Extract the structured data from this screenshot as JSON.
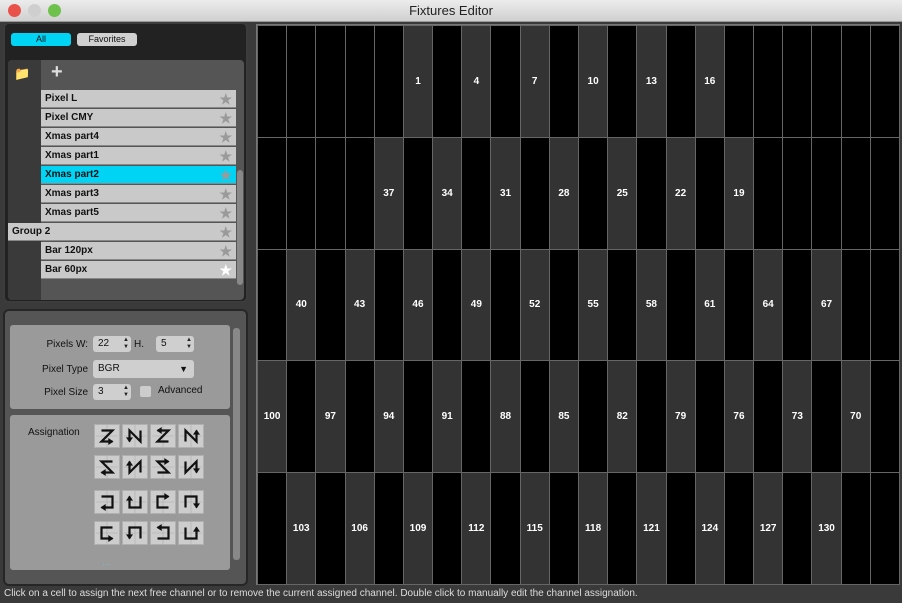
{
  "window": {
    "title": "Fixtures Editor"
  },
  "filters": [
    {
      "label": "All",
      "active": true
    },
    {
      "label": "Favorites",
      "active": false
    }
  ],
  "list": {
    "add_icon": "plus-icon",
    "folder_icon": "add-folder-icon",
    "items": [
      {
        "label": "Pixel L",
        "level": 1,
        "favorite": false,
        "selected": false
      },
      {
        "label": "Pixel CMY",
        "level": 1,
        "favorite": false,
        "selected": false
      },
      {
        "label": "Xmas part4",
        "level": 1,
        "favorite": false,
        "selected": false
      },
      {
        "label": "Xmas part1",
        "level": 1,
        "favorite": false,
        "selected": false
      },
      {
        "label": "Xmas part2",
        "level": 1,
        "favorite": false,
        "selected": true
      },
      {
        "label": "Xmas part3",
        "level": 1,
        "favorite": false,
        "selected": false
      },
      {
        "label": "Xmas part5",
        "level": 1,
        "favorite": false,
        "selected": false
      },
      {
        "label": "Group 2",
        "level": 0,
        "favorite": false,
        "selected": false
      },
      {
        "label": "Bar 120px",
        "level": 1,
        "favorite": false,
        "selected": false
      },
      {
        "label": "Bar 60px",
        "level": 1,
        "favorite": true,
        "selected": false
      }
    ]
  },
  "settings": {
    "pixels_w_label": "Pixels W:",
    "pixels_w": "22",
    "h_label": "H.",
    "h": "5",
    "pixel_type_label": "Pixel Type",
    "pixel_type": "BGR",
    "pixel_size_label": "Pixel Size",
    "pixel_size": "3",
    "advanced_label": "Advanced",
    "advanced": false,
    "assignation_label": "Assignation",
    "assignation_icons": [
      "z-arrow-right",
      "n-arrow-down",
      "z-arrow-left",
      "n-arrow-up",
      "s-arrow-left",
      "n-rev-arrow-up",
      "s-arrow-right",
      "n-rev-arrow-down",
      "snake-left",
      "snake-up",
      "snake-right",
      "snake-down",
      "snake-right-b",
      "snake-down-b",
      "snake-left-b",
      "snake-up-b"
    ]
  },
  "grid": {
    "columns": 22,
    "rows": 5,
    "assigned": [
      [
        [
          5,
          "1"
        ],
        [
          7,
          "4"
        ],
        [
          9,
          "7"
        ],
        [
          11,
          "10"
        ],
        [
          13,
          "13"
        ],
        [
          15,
          "16"
        ]
      ],
      [
        [
          4,
          "37"
        ],
        [
          6,
          "34"
        ],
        [
          8,
          "31"
        ],
        [
          10,
          "28"
        ],
        [
          12,
          "25"
        ],
        [
          14,
          "22"
        ],
        [
          16,
          "19"
        ]
      ],
      [
        [
          1,
          "40"
        ],
        [
          3,
          "43"
        ],
        [
          5,
          "46"
        ],
        [
          7,
          "49"
        ],
        [
          9,
          "52"
        ],
        [
          11,
          "55"
        ],
        [
          13,
          "58"
        ],
        [
          15,
          "61"
        ],
        [
          17,
          "64"
        ],
        [
          19,
          "67"
        ]
      ],
      [
        [
          0,
          "100"
        ],
        [
          2,
          "97"
        ],
        [
          4,
          "94"
        ],
        [
          6,
          "91"
        ],
        [
          8,
          "88"
        ],
        [
          10,
          "85"
        ],
        [
          12,
          "82"
        ],
        [
          14,
          "79"
        ],
        [
          16,
          "76"
        ],
        [
          18,
          "73"
        ],
        [
          20,
          "70"
        ]
      ],
      [
        [
          1,
          "103"
        ],
        [
          3,
          "106"
        ],
        [
          5,
          "109"
        ],
        [
          7,
          "112"
        ],
        [
          9,
          "115"
        ],
        [
          11,
          "118"
        ],
        [
          13,
          "121"
        ],
        [
          15,
          "124"
        ],
        [
          17,
          "127"
        ],
        [
          19,
          "130"
        ]
      ]
    ]
  },
  "status": "Click on a cell to assign the next free channel or to remove the current assigned channel. Double click to manually edit the channel assignation.",
  "colors": {
    "accent": "#00d4f5",
    "assigned_cell": "#333333",
    "empty_cell": "#000000"
  }
}
